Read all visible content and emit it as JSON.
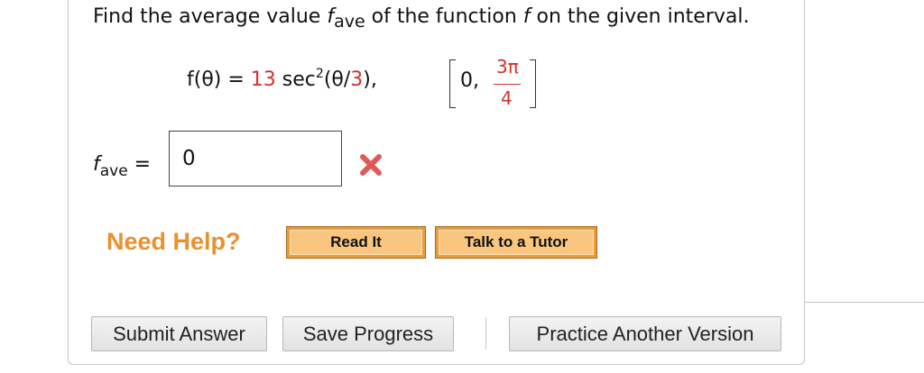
{
  "question": {
    "prefix": "Find the average value ",
    "f_symbol": "f",
    "sub": "ave",
    "middle": " of the function ",
    "f_symbol2": "f",
    "suffix": " on the given interval."
  },
  "formula": {
    "lhs": "f(θ)",
    "equals": " = ",
    "coef": "13",
    "func": " sec",
    "exp": "2",
    "arg_open": "(θ/",
    "arg_den": "3",
    "arg_close": "),",
    "interval_start": "0,",
    "interval_num": "3π",
    "interval_den": "4"
  },
  "answer": {
    "label_f": "f",
    "label_sub": "ave",
    "label_eq": " =",
    "value": "0",
    "status_icon": "x-mark-icon",
    "status_color": "#e05a5a"
  },
  "help": {
    "title": "Need Help?",
    "read_it": "Read It",
    "talk_to_tutor": "Talk to a Tutor",
    "accent": "#e8912e"
  },
  "actions": {
    "submit": "Submit Answer",
    "save": "Save Progress",
    "practice": "Practice Another Version"
  }
}
